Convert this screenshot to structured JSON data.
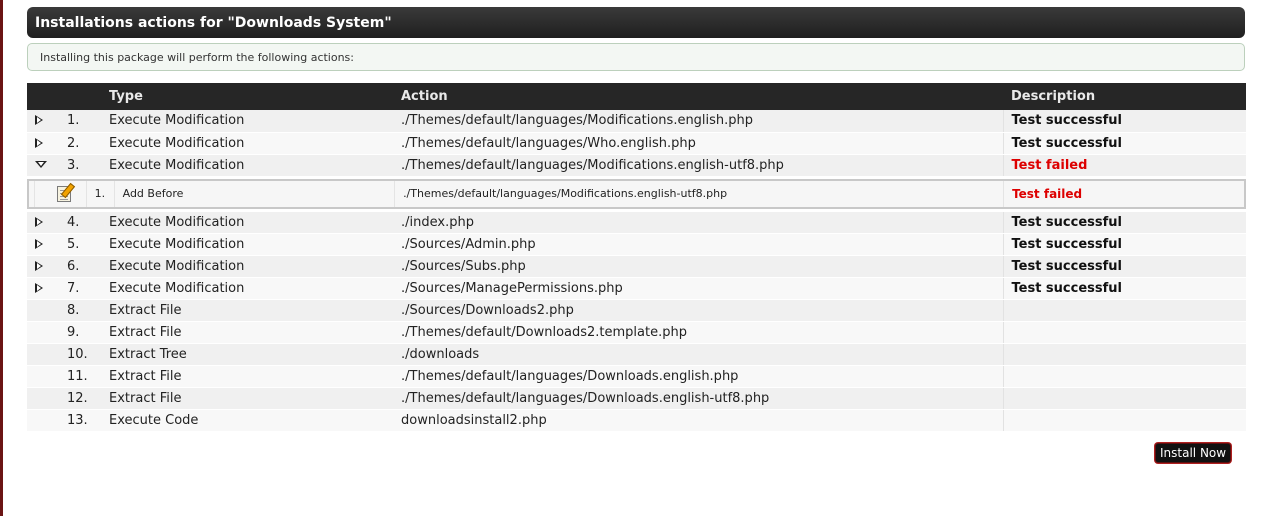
{
  "header": {
    "title": "Installations actions for \"Downloads System\""
  },
  "info": {
    "text": "Installing this package will perform the following actions:"
  },
  "table": {
    "columns": {
      "type": "Type",
      "action": "Action",
      "description": "Description"
    },
    "rows": [
      {
        "num": "1.",
        "type": "Execute Modification",
        "action": "./Themes/default/languages/Modifications.english.php",
        "desc": "Test successful",
        "status": "ok",
        "expander": "collapsed"
      },
      {
        "num": "2.",
        "type": "Execute Modification",
        "action": "./Themes/default/languages/Who.english.php",
        "desc": "Test successful",
        "status": "ok",
        "expander": "collapsed"
      },
      {
        "num": "3.",
        "type": "Execute Modification",
        "action": "./Themes/default/languages/Modifications.english-utf8.php",
        "desc": "Test failed",
        "status": "fail",
        "expander": "expanded"
      },
      {
        "num": "4.",
        "type": "Execute Modification",
        "action": "./index.php",
        "desc": "Test successful",
        "status": "ok",
        "expander": "collapsed"
      },
      {
        "num": "5.",
        "type": "Execute Modification",
        "action": "./Sources/Admin.php",
        "desc": "Test successful",
        "status": "ok",
        "expander": "collapsed"
      },
      {
        "num": "6.",
        "type": "Execute Modification",
        "action": "./Sources/Subs.php",
        "desc": "Test successful",
        "status": "ok",
        "expander": "collapsed"
      },
      {
        "num": "7.",
        "type": "Execute Modification",
        "action": "./Sources/ManagePermissions.php",
        "desc": "Test successful",
        "status": "ok",
        "expander": "collapsed"
      },
      {
        "num": "8.",
        "type": "Extract File",
        "action": "./Sources/Downloads2.php",
        "desc": "",
        "status": "",
        "expander": "none"
      },
      {
        "num": "9.",
        "type": "Extract File",
        "action": "./Themes/default/Downloads2.template.php",
        "desc": "",
        "status": "",
        "expander": "none"
      },
      {
        "num": "10.",
        "type": "Extract Tree",
        "action": "./downloads",
        "desc": "",
        "status": "",
        "expander": "none"
      },
      {
        "num": "11.",
        "type": "Extract File",
        "action": "./Themes/default/languages/Downloads.english.php",
        "desc": "",
        "status": "",
        "expander": "none"
      },
      {
        "num": "12.",
        "type": "Extract File",
        "action": "./Themes/default/languages/Downloads.english-utf8.php",
        "desc": "",
        "status": "",
        "expander": "none"
      },
      {
        "num": "13.",
        "type": "Execute Code",
        "action": "downloadsinstall2.php",
        "desc": "",
        "status": "",
        "expander": "none"
      }
    ],
    "subactions": {
      "parent_num": "3.",
      "items": [
        {
          "num": "1.",
          "icon": "edit-icon",
          "type": "Add Before",
          "action": "./Themes/default/languages/Modifications.english-utf8.php",
          "desc": "Test failed",
          "status": "fail"
        }
      ]
    }
  },
  "buttons": {
    "install": "Install Now"
  },
  "colors": {
    "header_bg": "#262626",
    "fail": "#dd0000",
    "left_border": "#6b1414"
  }
}
